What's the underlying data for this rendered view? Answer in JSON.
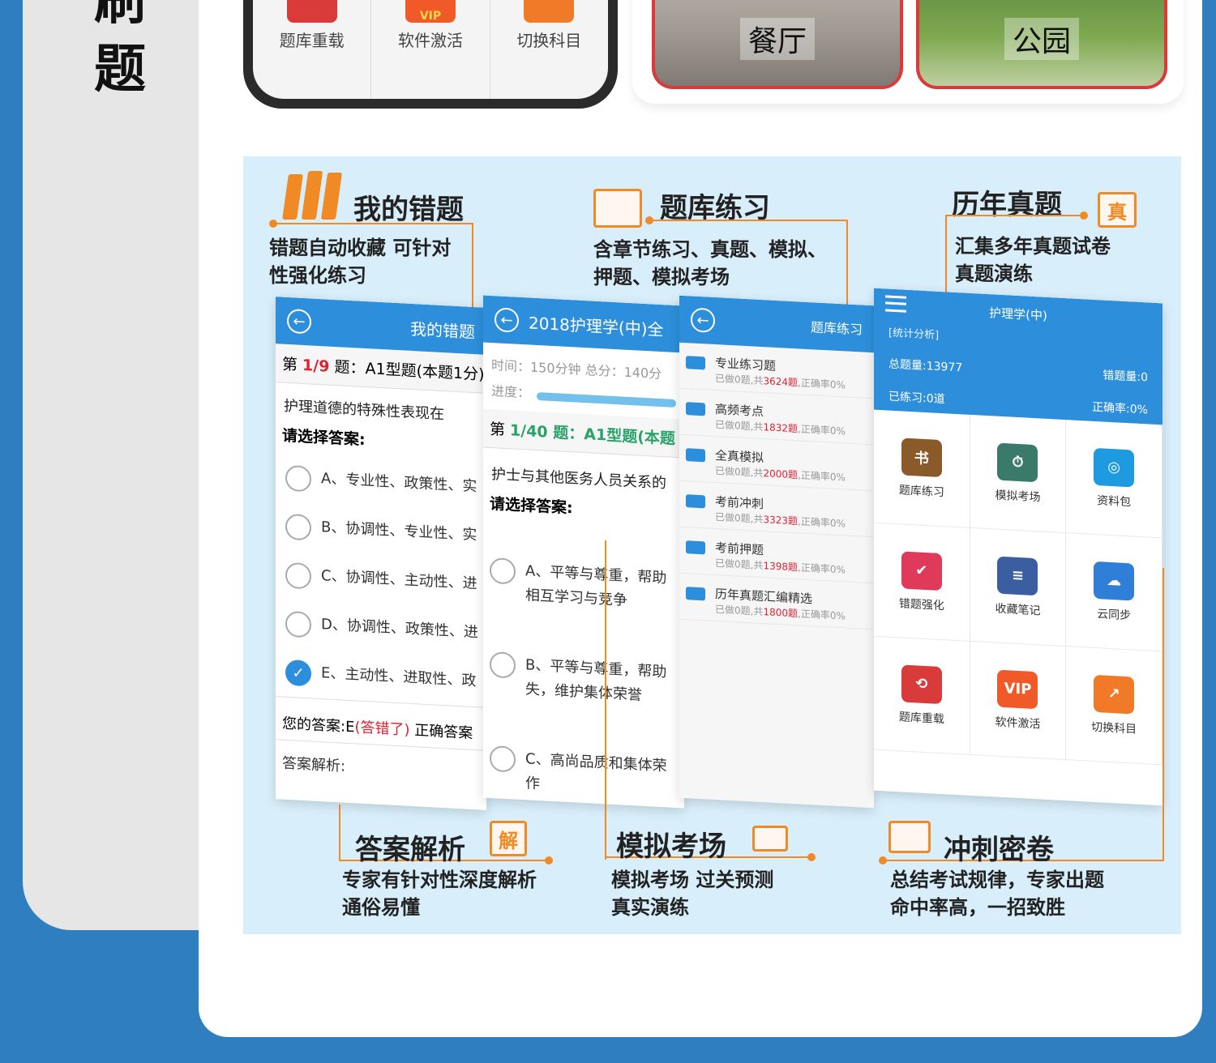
{
  "side_title": "刷题",
  "phone": {
    "cells": [
      {
        "label": "题库重载",
        "color": "#d93a3a",
        "badge": ""
      },
      {
        "label": "软件激活",
        "color": "#f05a28",
        "badge": "VIP"
      },
      {
        "label": "切换科目",
        "color": "#f07a28",
        "badge": ""
      }
    ]
  },
  "scenes": [
    {
      "label": "餐厅"
    },
    {
      "label": "公园"
    }
  ],
  "features": {
    "wrong": {
      "title": "我的错题",
      "desc1": "错题自动收藏 可针对",
      "desc2": "性强化练习"
    },
    "practice": {
      "title": "题库练习",
      "desc1": "含章节练习、真题、模拟、",
      "desc2": "押题、模拟考场"
    },
    "past": {
      "title": "历年真题",
      "desc1": "汇集多年真题试卷",
      "desc2": "真题演练",
      "icon": "真"
    },
    "analysis": {
      "title": "答案解析",
      "desc1": "专家有针对性深度解析",
      "desc2": "通俗易懂",
      "icon": "解"
    },
    "mock": {
      "title": "模拟考场",
      "desc1": "模拟考场 过关预测",
      "desc2": "真实演练"
    },
    "sprint": {
      "title": "冲刺密卷",
      "desc1": "总结考试规律，专家出题",
      "desc2": "命中率高，一招致胜"
    }
  },
  "shot1": {
    "title": "我的错题",
    "q_prefix": "第 ",
    "q_num": "1/9",
    "q_suffix": " 题：A1型题(本题1分)",
    "question": "护理道德的特殊性表现在",
    "choose": "请选择答案:",
    "options": [
      {
        "text": "A、专业性、政策性、实",
        "checked": false
      },
      {
        "text": "B、协调性、专业性、实",
        "checked": false
      },
      {
        "text": "C、协调性、主动性、进",
        "checked": false
      },
      {
        "text": "D、协调性、政策性、进",
        "checked": false
      },
      {
        "text": "E、主动性、进取性、政",
        "checked": true
      }
    ],
    "answer_prefix": "您的答案:E",
    "answer_wrong": "(答错了)",
    "answer_suffix": "  正确答案",
    "analysis": "答案解析:"
  },
  "shot2": {
    "title": "2018护理学(中)全",
    "time": "时间：150分钟  总分：140分",
    "progress_label": "进度：",
    "q_prefix": "第 ",
    "q_num": "1/40",
    "q_suffix": " 题：A1型题(本题",
    "question": "护士与其他医务人员关系的",
    "choose": "请选择答案:",
    "options": [
      {
        "text": "A、平等与尊重，帮助\n相互学习与竞争"
      },
      {
        "text": "B、平等与尊重，帮助\n失，维护集体荣誉"
      },
      {
        "text": "C、高尚品质和集体荣\n作"
      }
    ]
  },
  "shot3": {
    "title": "题库练习",
    "rows": [
      {
        "name": "专业练习题",
        "pre": "已做0题,共",
        "count": "3624题",
        "post": ",正确率0%"
      },
      {
        "name": "高频考点",
        "pre": "已做0题,共",
        "count": "1832题",
        "post": ",正确率0%"
      },
      {
        "name": "全真模拟",
        "pre": "已做0题,共",
        "count": "2000题",
        "post": ",正确率0%"
      },
      {
        "name": "考前冲刺",
        "pre": "已做0题,共",
        "count": "3323题",
        "post": ",正确率0%"
      },
      {
        "name": "考前押题",
        "pre": "已做0题,共",
        "count": "1398题",
        "post": ",正确率0%"
      },
      {
        "name": "历年真题汇编精选",
        "pre": "已做0题,共",
        "count": "1800题",
        "post": ",正确率0%"
      }
    ]
  },
  "shot4": {
    "title": "护理学(中)",
    "tag": "[统计分析]",
    "total": "总题量:13977",
    "wrong": "错题量:0",
    "done": "已练习:0道",
    "rate": "正确率:0%",
    "grid": [
      {
        "label": "题库练习",
        "color": "#8a5a2b",
        "icon": "书"
      },
      {
        "label": "模拟考场",
        "color": "#3a7a6a",
        "icon": "⏱"
      },
      {
        "label": "资料包",
        "color": "#1e9be0",
        "icon": "◎"
      },
      {
        "label": "错题强化",
        "color": "#e03a5a",
        "icon": "✔"
      },
      {
        "label": "收藏笔记",
        "color": "#3a5ea0",
        "icon": "≡"
      },
      {
        "label": "云同步",
        "color": "#2f7fd8",
        "icon": "☁"
      },
      {
        "label": "题库重载",
        "color": "#d93a3a",
        "icon": "⟲"
      },
      {
        "label": "软件激活",
        "color": "#f05a28",
        "icon": "VIP"
      },
      {
        "label": "切换科目",
        "color": "#f07a28",
        "icon": "↗"
      }
    ]
  }
}
